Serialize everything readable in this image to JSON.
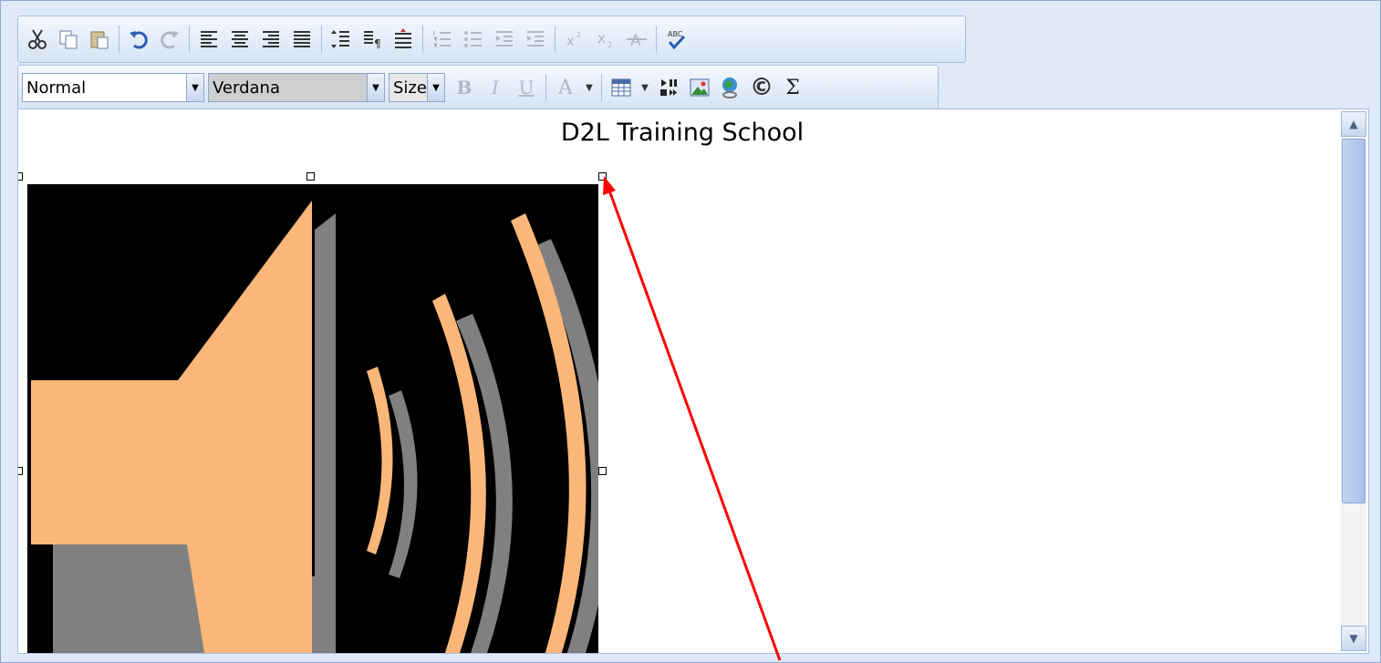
{
  "toolbar": {
    "row1_icons": [
      "cut-icon",
      "copy-icon",
      "paste-icon",
      "undo-icon",
      "redo-icon",
      "align-left-icon",
      "align-center-icon",
      "align-right-icon",
      "justify-icon",
      "line-spacing-icon",
      "paragraph-icon",
      "indent-line-icon",
      "ordered-list-icon",
      "unordered-list-icon",
      "outdent-icon",
      "indent-icon",
      "superscript-icon",
      "subscript-icon",
      "strikethrough-icon",
      "spellcheck-icon"
    ],
    "style_value": "Normal",
    "font_value": "Verdana",
    "size_value": "Size",
    "row2_icons": [
      "bold-icon",
      "italic-icon",
      "underline-icon",
      "font-color-icon",
      "table-icon",
      "media-icon",
      "image-icon",
      "link-icon",
      "copyright-icon",
      "sigma-icon"
    ],
    "bold_glyph": "B",
    "italic_glyph": "I",
    "underline_glyph": "U",
    "fontcolor_glyph": "A",
    "copyright_glyph": "©",
    "sigma_glyph": "Σ"
  },
  "editor": {
    "title": "D2L Training School",
    "image_icon": "speaker-icon"
  },
  "colors": {
    "speaker": "#fbb77a",
    "shadow": "#808080",
    "arrow": "#ff0000"
  }
}
